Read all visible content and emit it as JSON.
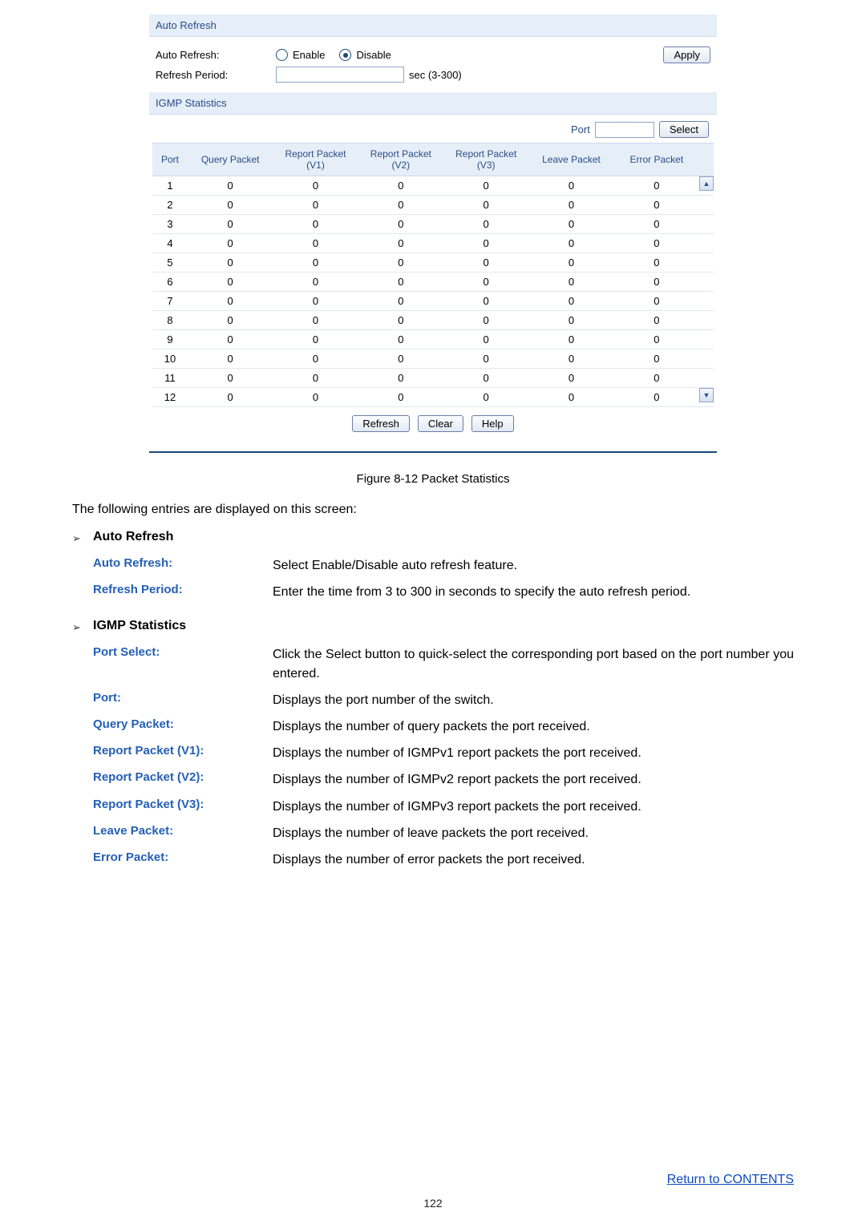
{
  "screenshot": {
    "autoRefresh": {
      "title": "Auto Refresh",
      "labels": {
        "autoRefresh": "Auto Refresh:",
        "refreshPeriod": "Refresh Period:"
      },
      "radios": {
        "enable": "Enable",
        "disable": "Disable",
        "selected": "disable"
      },
      "unit": "sec (3-300)",
      "applyBtn": "Apply"
    },
    "igmp": {
      "title": "IGMP Statistics",
      "portSelect": {
        "label": "Port",
        "value": "",
        "btn": "Select"
      },
      "headers": {
        "port": "Port",
        "query": "Query Packet",
        "v1a": "Report Packet",
        "v1b": "(V1)",
        "v2a": "Report Packet",
        "v2b": "(V2)",
        "v3a": "Report Packet",
        "v3b": "(V3)",
        "leave": "Leave Packet",
        "error": "Error Packet"
      },
      "rows": [
        {
          "port": "1",
          "query": "0",
          "v1": "0",
          "v2": "0",
          "v3": "0",
          "leave": "0",
          "error": "0"
        },
        {
          "port": "2",
          "query": "0",
          "v1": "0",
          "v2": "0",
          "v3": "0",
          "leave": "0",
          "error": "0"
        },
        {
          "port": "3",
          "query": "0",
          "v1": "0",
          "v2": "0",
          "v3": "0",
          "leave": "0",
          "error": "0"
        },
        {
          "port": "4",
          "query": "0",
          "v1": "0",
          "v2": "0",
          "v3": "0",
          "leave": "0",
          "error": "0"
        },
        {
          "port": "5",
          "query": "0",
          "v1": "0",
          "v2": "0",
          "v3": "0",
          "leave": "0",
          "error": "0"
        },
        {
          "port": "6",
          "query": "0",
          "v1": "0",
          "v2": "0",
          "v3": "0",
          "leave": "0",
          "error": "0"
        },
        {
          "port": "7",
          "query": "0",
          "v1": "0",
          "v2": "0",
          "v3": "0",
          "leave": "0",
          "error": "0"
        },
        {
          "port": "8",
          "query": "0",
          "v1": "0",
          "v2": "0",
          "v3": "0",
          "leave": "0",
          "error": "0"
        },
        {
          "port": "9",
          "query": "0",
          "v1": "0",
          "v2": "0",
          "v3": "0",
          "leave": "0",
          "error": "0"
        },
        {
          "port": "10",
          "query": "0",
          "v1": "0",
          "v2": "0",
          "v3": "0",
          "leave": "0",
          "error": "0"
        },
        {
          "port": "11",
          "query": "0",
          "v1": "0",
          "v2": "0",
          "v3": "0",
          "leave": "0",
          "error": "0"
        },
        {
          "port": "12",
          "query": "0",
          "v1": "0",
          "v2": "0",
          "v3": "0",
          "leave": "0",
          "error": "0"
        }
      ],
      "buttons": {
        "refresh": "Refresh",
        "clear": "Clear",
        "help": "Help"
      }
    }
  },
  "figureCaption": "Figure 8-12 Packet Statistics",
  "introLine": "The following entries are displayed on this screen:",
  "sections": {
    "autoRefresh": {
      "title": "Auto Refresh",
      "defs": [
        {
          "term": "Auto Refresh:",
          "desc": "Select Enable/Disable auto refresh feature."
        },
        {
          "term": "Refresh Period:",
          "desc": "Enter the time from 3 to 300 in seconds to specify the auto refresh period."
        }
      ]
    },
    "igmp": {
      "title": "IGMP Statistics",
      "defs": [
        {
          "term": "Port Select:",
          "desc": "Click the Select button to quick-select the corresponding port based on the port number you entered."
        },
        {
          "term": "Port:",
          "desc": "Displays the port number of the switch."
        },
        {
          "term": "Query Packet:",
          "desc": "Displays the number of query packets the port received."
        },
        {
          "term": "Report Packet (V1):",
          "desc": "Displays the number of IGMPv1 report packets the port received."
        },
        {
          "term": "Report Packet (V2):",
          "desc": "Displays the number of IGMPv2 report packets the port received."
        },
        {
          "term": "Report Packet (V3):",
          "desc": "Displays the number of IGMPv3 report packets the port received."
        },
        {
          "term": "Leave Packet:",
          "desc": "Displays the number of leave packets the port received."
        },
        {
          "term": "Error Packet:",
          "desc": "Displays the number of error packets the port received."
        }
      ]
    }
  },
  "returnLink": "Return to CONTENTS",
  "pageNumber": "122"
}
